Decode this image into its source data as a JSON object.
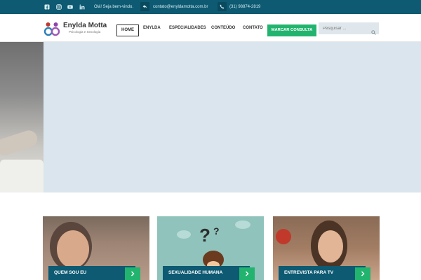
{
  "topbar": {
    "greeting": "Olá! Seja bem-vindo.",
    "email": "contato@enyldamotta.com.br",
    "phone": "(31) 98874-2819",
    "social": [
      "facebook-icon",
      "instagram-icon",
      "youtube-icon",
      "linkedin-icon"
    ]
  },
  "header": {
    "brand": "Enylda Motta",
    "tagline": "Psicologia e Sexologia",
    "nav": {
      "home": "HOME",
      "enylda": "ENYLDA",
      "especialidades": "ESPECIALIDADES",
      "conteudo": "CONTEÚDO",
      "contato": "CONTATO"
    },
    "cta": "MARCAR CONSULTA",
    "search_placeholder": "Pesquisar ..."
  },
  "cards": [
    {
      "label": "QUEM SOU EU"
    },
    {
      "label": "SEXUALIDADE HUMANA"
    },
    {
      "label": "ENTREVISTA PARA TV"
    }
  ],
  "colors": {
    "topbar": "#0d5a72",
    "accent_green": "#22b46e",
    "hero_bg": "#dae5ee"
  }
}
